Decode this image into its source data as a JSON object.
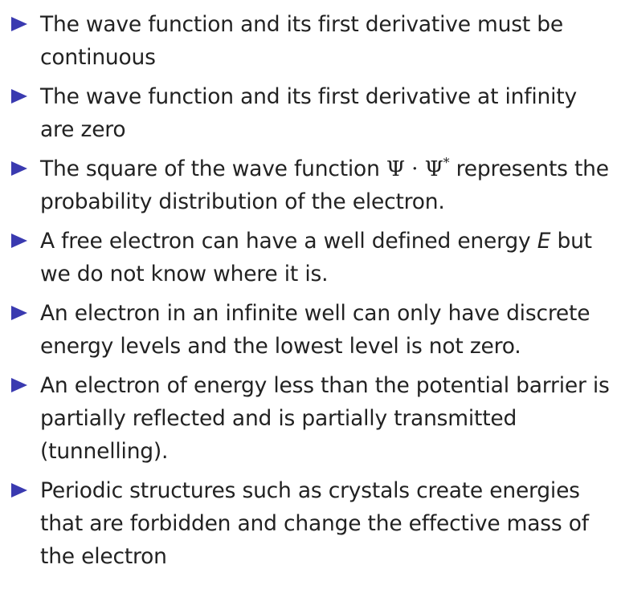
{
  "bullets": [
    {
      "text": "The wave function and its first derivative must be continuous",
      "marker_icon": "triangle-right-icon"
    },
    {
      "text": "The wave function and its first derivative at infinity are zero",
      "marker_icon": "triangle-right-icon"
    },
    {
      "text_pre": "The square of the wave function ",
      "math": "Ψ · Ψ",
      "math_sup": "*",
      "text_post": " represents the probability distribution of the electron.",
      "marker_icon": "triangle-right-icon"
    },
    {
      "text_pre": "A free electron can have a well defined energy ",
      "var": "E",
      "text_post": " but we do not know where it is.",
      "marker_icon": "triangle-right-icon"
    },
    {
      "text": "An electron in an infinite well can only have discrete energy levels and the lowest level is not zero.",
      "marker_icon": "triangle-right-icon"
    },
    {
      "text": "An electron of energy less than the potential barrier is partially reflected and is partially transmitted (tunnelling).",
      "marker_icon": "triangle-right-icon"
    },
    {
      "text": "Periodic structures such as crystals create energies that are forbidden and change the effective mass of the electron",
      "marker_icon": "triangle-right-icon"
    }
  ],
  "colors": {
    "bullet_marker": "#3a3ab0",
    "text": "#222222",
    "background": "#ffffff"
  }
}
